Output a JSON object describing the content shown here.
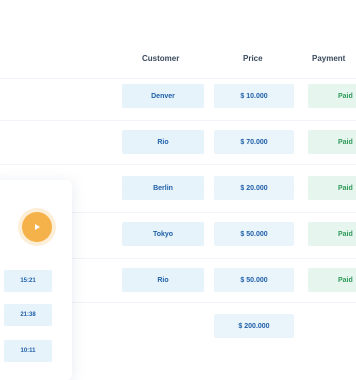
{
  "table": {
    "headers": {
      "customer": "Customer",
      "price": "Price",
      "payment": "Payment"
    },
    "rows": [
      {
        "customer": "Denver",
        "price": "$ 10.000",
        "payment": "Paid"
      },
      {
        "customer": "Rio",
        "price": "$ 70.000",
        "payment": "Paid"
      },
      {
        "customer": "Berlin",
        "price": "$ 20.000",
        "payment": "Paid"
      },
      {
        "customer": "Tokyo",
        "price": "$ 50.000",
        "payment": "Paid"
      },
      {
        "customer": "Rio",
        "price": "$ 50.000",
        "payment": "Paid"
      }
    ],
    "total": "$ 200.000"
  },
  "player": {
    "play_icon": "play-icon",
    "times": [
      "15:21",
      "21:38",
      "10:11"
    ]
  },
  "colors": {
    "accent": "#f6b24a",
    "primary_text": "#1f5fa8",
    "paid": "#2f9a5a"
  }
}
